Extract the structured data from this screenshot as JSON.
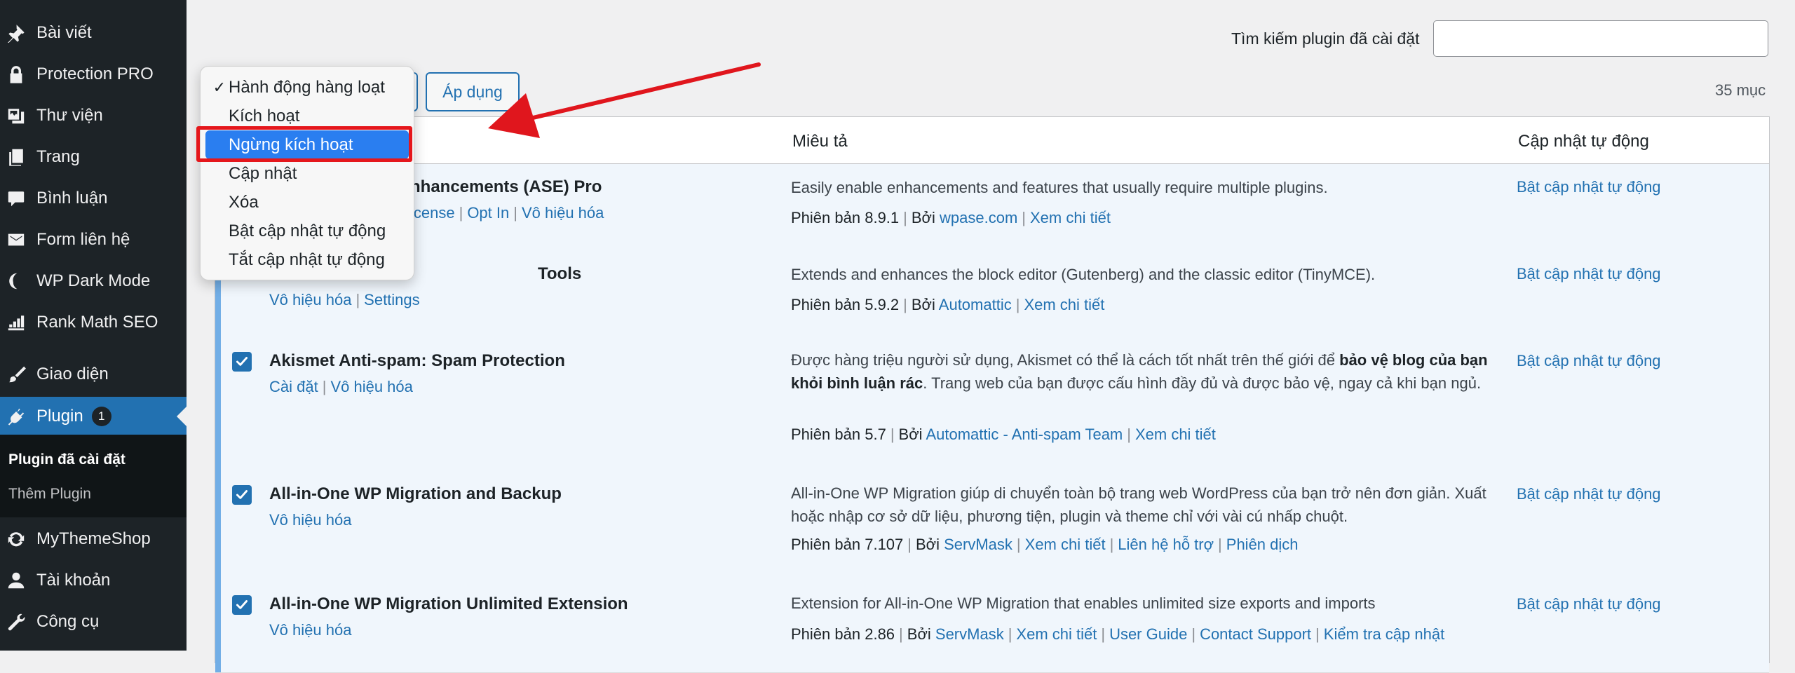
{
  "sidebar": {
    "items": [
      {
        "label": "Bài viết",
        "icon": "pin-icon"
      },
      {
        "label": "Protection PRO",
        "icon": "lock-icon"
      },
      {
        "label": "Thư viện",
        "icon": "media-icon"
      },
      {
        "label": "Trang",
        "icon": "page-icon"
      },
      {
        "label": "Bình luận",
        "icon": "comment-icon"
      },
      {
        "label": "Form liên hệ",
        "icon": "mail-icon"
      },
      {
        "label": "WP Dark Mode",
        "icon": "moon-icon"
      },
      {
        "label": "Rank Math SEO",
        "icon": "chart-icon"
      },
      {
        "label": "Giao diện",
        "icon": "brush-icon"
      },
      {
        "label": "Plugin",
        "icon": "plugin-icon",
        "badge": "1"
      },
      {
        "label": "MyThemeShop",
        "icon": "refresh-icon"
      },
      {
        "label": "Tài khoản",
        "icon": "user-icon"
      },
      {
        "label": "Công cụ",
        "icon": "wrench-icon"
      }
    ],
    "submenu": [
      {
        "label": "Plugin đã cài đặt"
      },
      {
        "label": "Thêm Plugin"
      }
    ]
  },
  "search": {
    "label": "Tìm kiếm plugin đã cài đặt",
    "value": "",
    "placeholder": ""
  },
  "items_count": "35 mục",
  "bulk": {
    "apply_label": "Áp dụng",
    "options": [
      {
        "label": "Hành động hàng loạt",
        "checked": true
      },
      {
        "label": "Kích hoạt"
      },
      {
        "label": "Ngừng kích hoạt",
        "highlighted": true
      },
      {
        "label": "Cập nhật"
      },
      {
        "label": "Xóa"
      },
      {
        "label": "Bật cập nhật tự động"
      },
      {
        "label": "Tắt cập nhật tự động"
      }
    ]
  },
  "table": {
    "headers": [
      "Miêu tả",
      "Cập nhật tự động"
    ],
    "version_prefix": "Phiên bản",
    "by_label": "Bởi",
    "rows": [
      {
        "name": "nhancements (ASE) Pro",
        "actions": [
          "icense",
          "Opt In",
          "Vô hiệu hóa"
        ],
        "description": "Easily enable enhancements and features that usually require multiple plugins.",
        "version": "8.9.1",
        "author": "wpase.com",
        "links": [
          "Xem chi tiết"
        ],
        "auto_update": "Bật cập nhật tự động"
      },
      {
        "name": "Tools",
        "actions": [
          "Vô hiệu hóa",
          "Settings"
        ],
        "description": "Extends and enhances the block editor (Gutenberg) and the classic editor (TinyMCE).",
        "version": "5.9.2",
        "author": "Automattic",
        "links": [
          "Xem chi tiết"
        ],
        "auto_update": "Bật cập nhật tự động"
      },
      {
        "name": "Akismet Anti-spam: Spam Protection",
        "actions": [
          "Cài đặt",
          "Vô hiệu hóa"
        ],
        "description_pre": "Được hàng triệu người sử dụng, Akismet có thể là cách tốt nhất trên thế giới để ",
        "description_bold": "bảo vệ blog của bạn khỏi bình luận rác",
        "description_post": ". Trang web của bạn được cấu hình đầy đủ và được bảo vệ, ngay cả khi bạn ngủ.",
        "version": "5.7",
        "author": "Automattic - Anti-spam Team",
        "links": [
          "Xem chi tiết"
        ],
        "auto_update": "Bật cập nhật tự động"
      },
      {
        "name": "All-in-One WP Migration and Backup",
        "actions": [
          "Vô hiệu hóa"
        ],
        "description": "All-in-One WP Migration giúp di chuyển toàn bộ trang web WordPress của bạn trở nên đơn giản. Xuất hoặc nhập cơ sở dữ liệu, phương tiện, plugin và theme chỉ với vài cú nhấp chuột.",
        "version": "7.107",
        "author": "ServMask",
        "links": [
          "Xem chi tiết",
          "Liên hệ hỗ trợ",
          "Phiên dịch"
        ],
        "auto_update": "Bật cập nhật tự động"
      },
      {
        "name": "All-in-One WP Migration Unlimited Extension",
        "actions": [
          "Vô hiệu hóa"
        ],
        "description": "Extension for All-in-One WP Migration that enables unlimited size exports and imports",
        "version": "2.86",
        "author": "ServMask",
        "links": [
          "Xem chi tiết",
          "User Guide",
          "Contact Support",
          "Kiểm tra cập nhật"
        ],
        "auto_update": "Bật cập nhật tự động"
      }
    ]
  },
  "colors": {
    "sidebar_bg": "#1d2327",
    "accent": "#2271b1",
    "active_row_bg": "#f0f6fc",
    "highlight_red": "#e5171c",
    "arrow_red": "#e0161d",
    "dropdown_selection": "#2a7ef0"
  }
}
